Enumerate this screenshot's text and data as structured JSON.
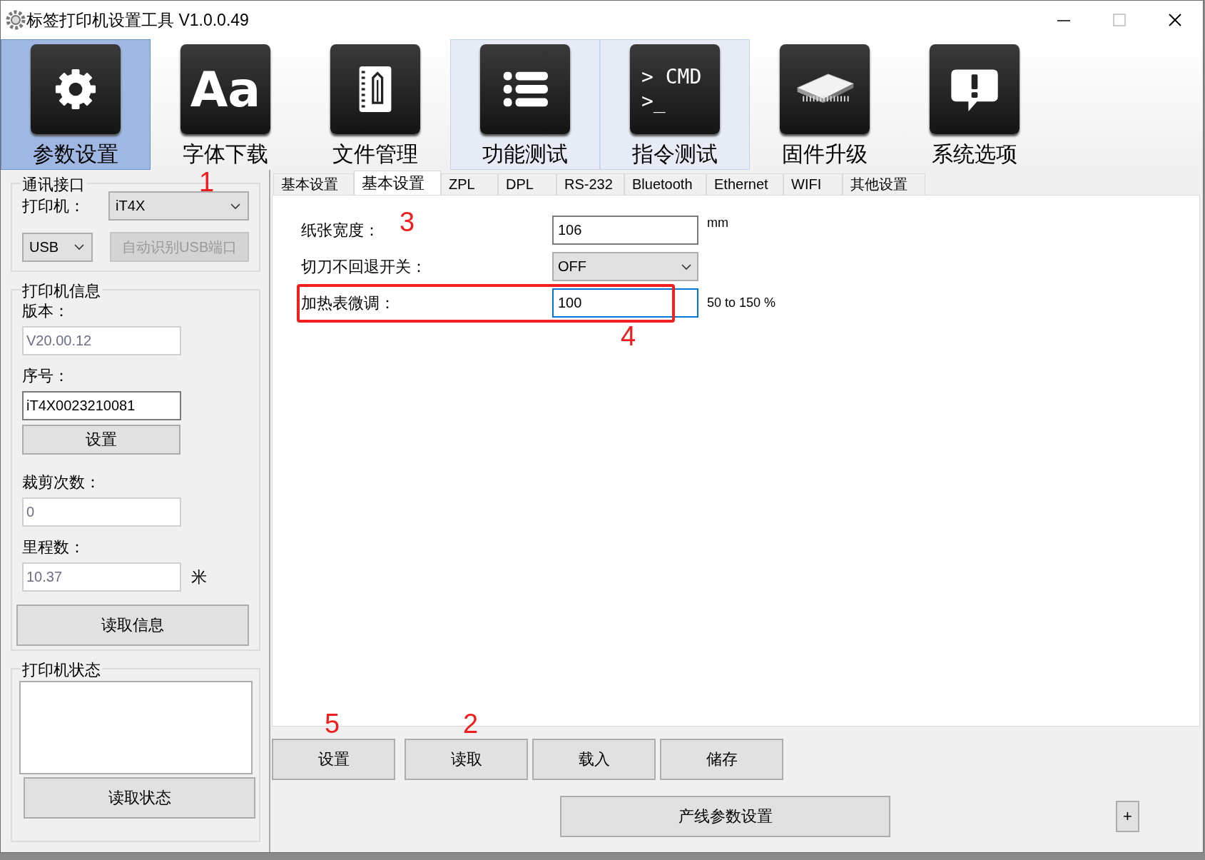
{
  "window": {
    "title": "标签打印机设置工具  V1.0.0.49"
  },
  "toolbar": [
    {
      "label": "参数设置",
      "kind": "gear",
      "selected": true,
      "highlighted": false
    },
    {
      "label": "字体下载",
      "kind": "text",
      "glyph": "Aa",
      "selected": false,
      "highlighted": false
    },
    {
      "label": "文件管理",
      "kind": "notebook",
      "selected": false,
      "highlighted": false
    },
    {
      "label": "功能测试",
      "kind": "list",
      "selected": false,
      "highlighted": true
    },
    {
      "label": "指令测试",
      "kind": "terminal",
      "glyph": "> CMD",
      "glyph_2": ">_",
      "selected": false,
      "highlighted": true
    },
    {
      "label": "固件升级",
      "kind": "chip",
      "selected": false,
      "highlighted": false
    },
    {
      "label": "系统选项",
      "kind": "alert",
      "selected": false,
      "highlighted": false
    }
  ],
  "sidebar": {
    "connection": {
      "title": "通讯接口",
      "printer_label": "打印机：",
      "printer_value": "iT4X",
      "port_value": "USB",
      "auto_button": {
        "label": "自动识别USB端口",
        "disabled": true
      },
      "annotation": "1"
    },
    "info": {
      "title": "打印机信息",
      "version_label": "版本：",
      "version_value": "V20.00.12",
      "serial_label": "序号：",
      "serial_value": "iT4X0023210081",
      "set_button": "设置",
      "cut_label": "裁剪次数：",
      "cut_value": "0",
      "mileage_label": "里程数：",
      "mileage_value": "10.37",
      "mileage_unit": "米",
      "read_button": "读取信息"
    },
    "status": {
      "title": "打印机状态",
      "read_button": "读取状态"
    }
  },
  "tabs": [
    {
      "label": "基本设置",
      "selected": false
    },
    {
      "label": "基本设置",
      "selected": true
    },
    {
      "label": "ZPL",
      "selected": false
    },
    {
      "label": "DPL",
      "selected": false
    },
    {
      "label": "RS-232",
      "selected": false
    },
    {
      "label": "Bluetooth",
      "selected": false
    },
    {
      "label": "Ethernet",
      "selected": false
    },
    {
      "label": "WIFI",
      "selected": false
    },
    {
      "label": "其他设置",
      "selected": false
    }
  ],
  "settings": [
    {
      "label": "纸张宽度：",
      "kind": "input",
      "value": "106",
      "unit": "mm",
      "annotation": "3",
      "highlighted": false,
      "focused": false
    },
    {
      "label": "切刀不回退开关：",
      "kind": "select",
      "value": "OFF",
      "highlighted": false,
      "focused": false
    },
    {
      "label": "加热表微调：",
      "kind": "input",
      "value": "100",
      "unit": "50 to 150 %",
      "annotation": "4",
      "highlighted": true,
      "focused": true
    }
  ],
  "buttons": [
    {
      "label": "设置",
      "annotation": "5"
    },
    {
      "label": "读取",
      "annotation": "2"
    },
    {
      "label": "载入"
    },
    {
      "label": "储存"
    }
  ],
  "production_button": "产线参数设置",
  "expand_button": "+"
}
